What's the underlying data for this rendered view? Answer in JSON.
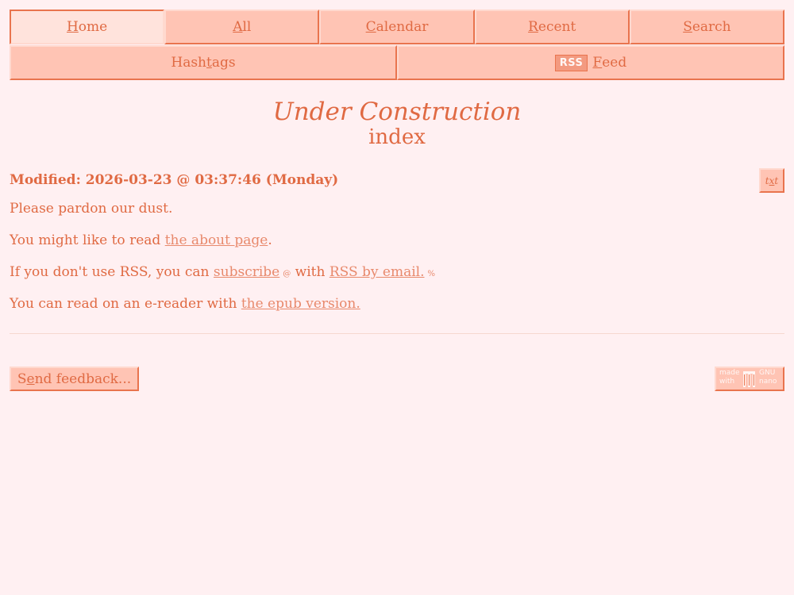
{
  "nav": {
    "row1": [
      {
        "key": "H",
        "rest": "ome",
        "active": true
      },
      {
        "key": "A",
        "rest": "ll"
      },
      {
        "key": "C",
        "rest": "alendar"
      },
      {
        "key": "R",
        "rest": "ecent"
      },
      {
        "key": "S",
        "rest": "earch"
      }
    ],
    "row2": {
      "hashtags_pre": "Hash",
      "hashtags_key": "t",
      "hashtags_post": "ags",
      "rss_badge": "RSS",
      "feed_key": "F",
      "feed_rest": "eed"
    }
  },
  "page": {
    "title": "Under Construction",
    "subtitle": "index",
    "modified": "Modified: 2026-03-23 @ 03:37:46 (Monday)",
    "txt_button": {
      "pre": "t",
      "key": "x",
      "post": "t"
    }
  },
  "content": {
    "p1": "Please pardon our dust.",
    "p2_pre": "You might like to read ",
    "p2_link": "the about page",
    "p2_post": ".",
    "p3_pre": "If you don't use RSS, you can ",
    "p3_link1": "subscribe",
    "p3_icon1": "@",
    "p3_mid": " with ",
    "p3_link2": "RSS by email.",
    "p3_icon2": "%",
    "p4_pre": "You can read on an e-reader with ",
    "p4_link": "the epub version."
  },
  "footer": {
    "feedback_pre": "S",
    "feedback_key": "e",
    "feedback_post": "nd feedback...",
    "badge_made": "made with",
    "badge_gnu": "GNU nano"
  },
  "colors": {
    "background": "#fff0f2",
    "text": "#e06a43",
    "button": "#ffc4b4",
    "button_active": "#ffe3dc",
    "link": "#e8896c"
  }
}
